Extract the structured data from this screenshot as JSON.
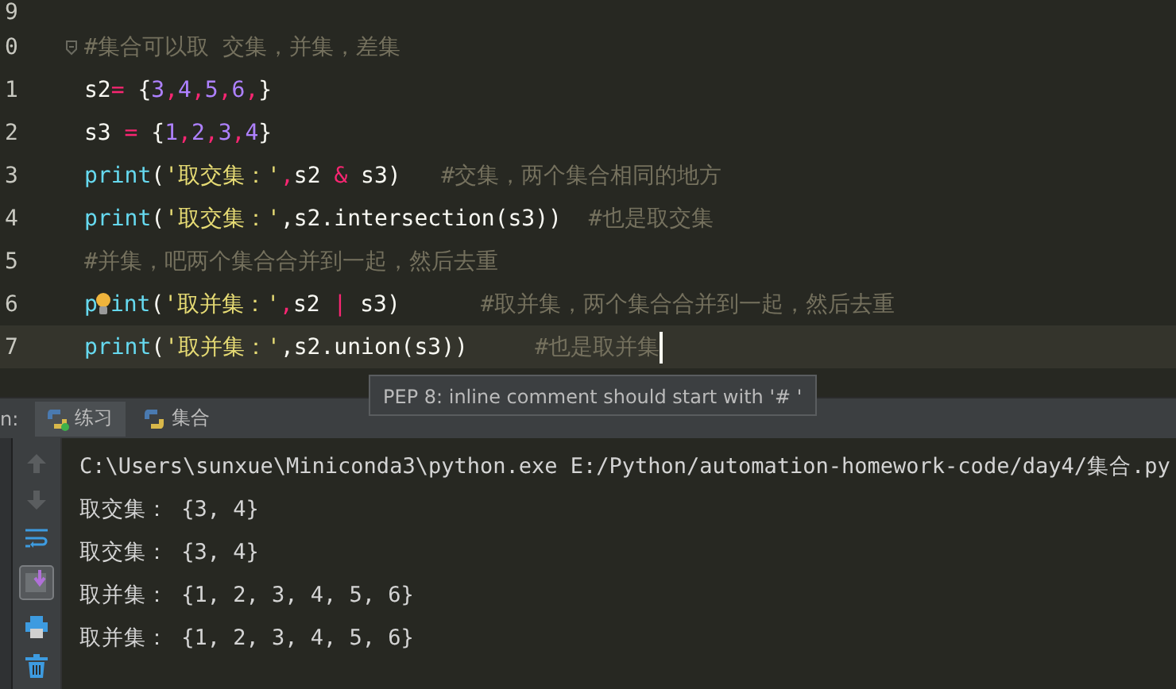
{
  "editor": {
    "lines": [
      {
        "number": "9",
        "fold": false,
        "current": false
      },
      {
        "number": "0",
        "fold": true,
        "current": false,
        "tokens": [
          {
            "kind": "comment",
            "text": "#集合可以取 交集，并集，差集"
          }
        ]
      },
      {
        "number": "1",
        "fold": false,
        "current": false,
        "tokens": [
          {
            "kind": "plain",
            "text": "s2"
          },
          {
            "kind": "op",
            "text": "="
          },
          {
            "kind": "plain",
            "text": " {"
          },
          {
            "kind": "num",
            "text": "3"
          },
          {
            "kind": "op",
            "text": ","
          },
          {
            "kind": "num",
            "text": "4"
          },
          {
            "kind": "op",
            "text": ","
          },
          {
            "kind": "num",
            "text": "5"
          },
          {
            "kind": "op",
            "text": ","
          },
          {
            "kind": "num",
            "text": "6"
          },
          {
            "kind": "op",
            "text": ","
          },
          {
            "kind": "plain",
            "text": "}"
          }
        ]
      },
      {
        "number": "2",
        "fold": false,
        "current": false,
        "tokens": [
          {
            "kind": "plain",
            "text": "s3 "
          },
          {
            "kind": "op",
            "text": "="
          },
          {
            "kind": "plain",
            "text": " {"
          },
          {
            "kind": "num",
            "text": "1"
          },
          {
            "kind": "op",
            "text": ","
          },
          {
            "kind": "num",
            "text": "2"
          },
          {
            "kind": "op",
            "text": ","
          },
          {
            "kind": "num",
            "text": "3"
          },
          {
            "kind": "op",
            "text": ","
          },
          {
            "kind": "num",
            "text": "4"
          },
          {
            "kind": "plain",
            "text": "}"
          }
        ]
      },
      {
        "number": "3",
        "fold": false,
        "current": false,
        "tokens": [
          {
            "kind": "builtin",
            "text": "print"
          },
          {
            "kind": "plain",
            "text": "("
          },
          {
            "kind": "str",
            "text": "'取交集：'"
          },
          {
            "kind": "op",
            "text": ","
          },
          {
            "kind": "plain",
            "text": "s2 "
          },
          {
            "kind": "op",
            "text": "&"
          },
          {
            "kind": "plain",
            "text": " s3)   "
          },
          {
            "kind": "comment",
            "text": "#交集，两个集合相同的地方"
          }
        ]
      },
      {
        "number": "4",
        "fold": false,
        "current": false,
        "tokens": [
          {
            "kind": "builtin",
            "text": "print"
          },
          {
            "kind": "plain",
            "text": "("
          },
          {
            "kind": "str",
            "text": "'取交集：'"
          },
          {
            "kind": "plain",
            "text": ",s2.intersection(s3))  "
          },
          {
            "kind": "comment",
            "text": "#也是取交集"
          }
        ]
      },
      {
        "number": "5",
        "fold": false,
        "current": false,
        "tokens": [
          {
            "kind": "comment",
            "text": "#并集，吧两个集合合并到一起，然后去重"
          }
        ]
      },
      {
        "number": "6",
        "fold": false,
        "current": false,
        "tokens": [
          {
            "kind": "builtin",
            "text": "p"
          },
          {
            "kind": "bulb"
          },
          {
            "kind": "builtin",
            "text": "int"
          },
          {
            "kind": "plain",
            "text": "("
          },
          {
            "kind": "str",
            "text": "'取并集：'"
          },
          {
            "kind": "op",
            "text": ","
          },
          {
            "kind": "plain",
            "text": "s2 "
          },
          {
            "kind": "op",
            "text": "|"
          },
          {
            "kind": "plain",
            "text": " s3)      "
          },
          {
            "kind": "comment",
            "text": "#取并集，两个集合合并到一起，然后去重"
          }
        ]
      },
      {
        "number": "7",
        "fold": false,
        "current": true,
        "tokens": [
          {
            "kind": "builtin",
            "text": "print"
          },
          {
            "kind": "plain",
            "text": "("
          },
          {
            "kind": "str",
            "text": "'取并集：'"
          },
          {
            "kind": "plain",
            "text": ",s2.union(s3))     "
          },
          {
            "kind": "comment",
            "text": "#也是取并集"
          },
          {
            "kind": "caret"
          }
        ]
      }
    ]
  },
  "tooltip": "PEP 8: inline comment should start with '# '",
  "run": {
    "label": "n:",
    "tabs": [
      {
        "label": "练习",
        "selected": true
      },
      {
        "label": "集合",
        "selected": false
      }
    ],
    "tools": [
      {
        "kind": "up"
      },
      {
        "kind": "down"
      },
      {
        "kind": "wrap"
      },
      {
        "kind": "scroll"
      },
      {
        "kind": "print"
      },
      {
        "kind": "trash"
      }
    ],
    "output": [
      "C:\\Users\\sunxue\\Miniconda3\\python.exe E:/Python/automation-homework-code/day4/集合.py",
      "取交集： {3, 4}",
      "取交集： {3, 4}",
      "取并集： {1, 2, 3, 4, 5, 6}",
      "取并集： {1, 2, 3, 4, 5, 6}"
    ]
  }
}
